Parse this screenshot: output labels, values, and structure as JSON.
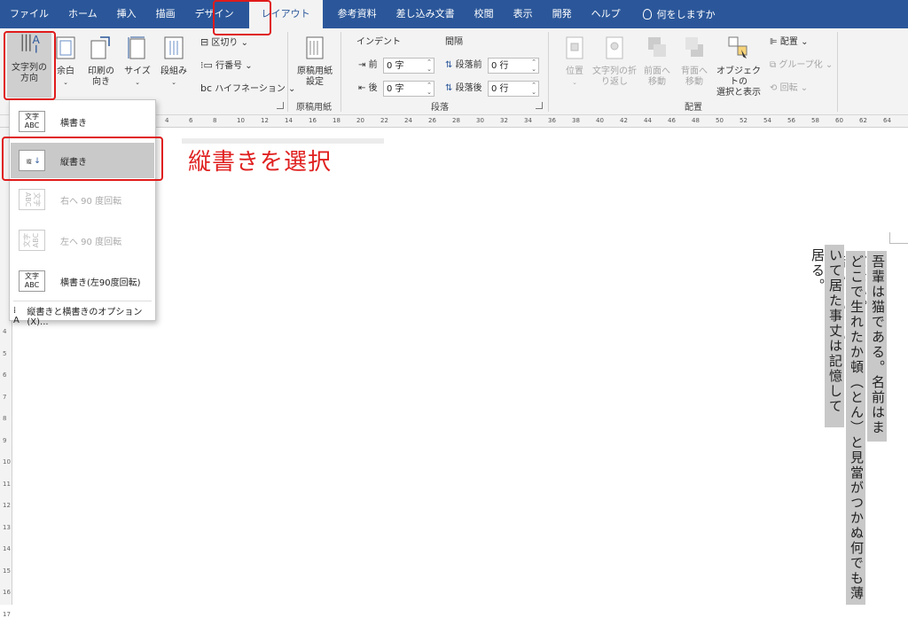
{
  "tabs": [
    "ファイル",
    "ホーム",
    "挿入",
    "描画",
    "デザイン",
    "レイアウト",
    "参考資料",
    "差し込み文書",
    "校閲",
    "表示",
    "開発",
    "ヘルプ"
  ],
  "active_tab": "レイアウト",
  "tell_me": "何をしますか",
  "ribbon": {
    "page_setup": {
      "text_direction": "文字列の\n方向",
      "margins": "余白",
      "orientation": "印刷の\n向き",
      "size": "サイズ",
      "columns": "段組み",
      "breaks": "区切り",
      "line_numbers": "行番号",
      "hyphenation": "ハイフネーション",
      "hyphen_glyph": "bc"
    },
    "manuscript": {
      "button": "原稿用紙\n設定",
      "group": "原稿用紙"
    },
    "paragraph": {
      "indent_label": "インデント",
      "spacing_label": "間隔",
      "indent_left_label": "前",
      "indent_left_value": "0 字",
      "indent_right_label": "後",
      "indent_right_value": "0 字",
      "space_before_label": "段落前",
      "space_before_value": "0 行",
      "space_after_label": "段落後",
      "space_after_value": "0 行",
      "group": "段落"
    },
    "arrange": {
      "position": "位置",
      "wrap_text": "文字列の折\nり返し",
      "bring_forward": "前面へ\n移動",
      "send_backward": "背面へ\n移動",
      "selection_pane": "オブジェクトの\n選択と表示",
      "align": "配置",
      "group_btn": "グループ化",
      "rotate": "回転",
      "group": "配置"
    }
  },
  "ruler_marks": [
    "4",
    "6",
    "8",
    "10",
    "12",
    "14",
    "16",
    "18",
    "20",
    "22",
    "24",
    "26",
    "28",
    "30",
    "32",
    "34",
    "36",
    "38",
    "40",
    "42",
    "44",
    "46",
    "48",
    "50",
    "52",
    "54",
    "56",
    "58",
    "60",
    "62",
    "64"
  ],
  "vruler_marks": [
    "4",
    "5",
    "6",
    "7",
    "8",
    "9",
    "10",
    "11",
    "12",
    "13",
    "14",
    "15",
    "16",
    "17"
  ],
  "dropdown": {
    "items": [
      {
        "label": "横書き",
        "icon": "文字\nABC"
      },
      {
        "label": "縦書き",
        "icon": "縦"
      },
      {
        "label": "右へ 90 度回転",
        "icon": "文字\nABC"
      },
      {
        "label": "左へ 90 度回転",
        "icon": "文字\nABC"
      },
      {
        "label": "横書き(左90度回転)",
        "icon": "文字\nABC"
      }
    ],
    "options": "縦書きと横書きのオプション(X)..."
  },
  "instruction": "縦書きを選択",
  "document": {
    "column1": "吾輩は猫である。名前はまだない。",
    "column2": "どこで生れたか頓（とん）と見當がつかぬ何でも薄暗いじめじめ",
    "column3": "いて居た事丈は記憶して居る。"
  },
  "colors": {
    "tab_bar": "#2b579a",
    "highlight": "#e01b1b"
  }
}
